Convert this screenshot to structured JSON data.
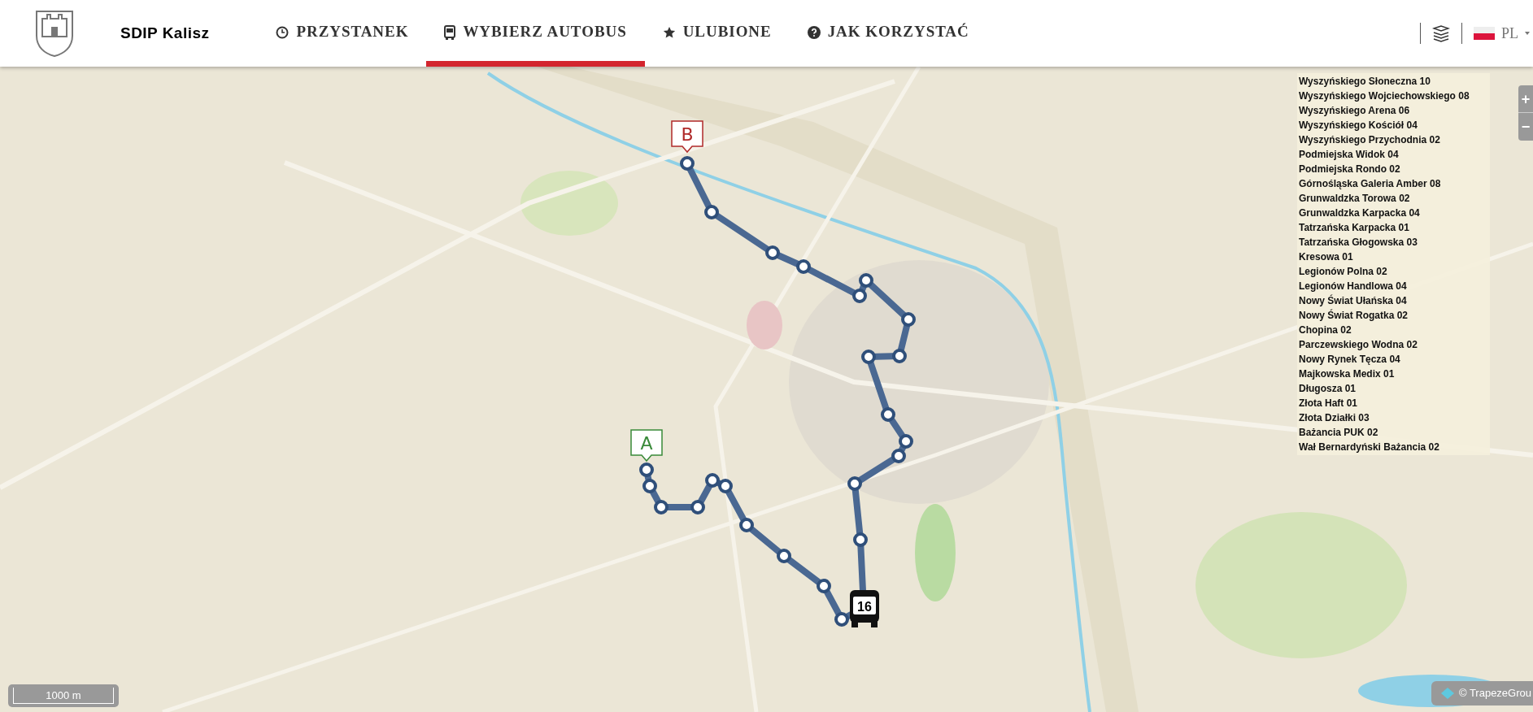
{
  "header": {
    "title": "SDIP Kalisz",
    "nav": [
      {
        "label": "PRZYSTANEK",
        "selected": false
      },
      {
        "label": "WYBIERZ AUTOBUS",
        "selected": true
      },
      {
        "label": "ULUBIONE",
        "selected": false
      },
      {
        "label": "JAK KORZYSTAĆ",
        "selected": false
      }
    ],
    "language": "PL"
  },
  "map": {
    "kind": "picture",
    "markers": [
      {
        "label": "A"
      },
      {
        "label": "B"
      }
    ],
    "bus": {
      "line": "16"
    },
    "zoom_buttons": [
      "+",
      "−"
    ],
    "scale": "1000 m",
    "attribution": "© TrapezeGrou"
  },
  "stops": [
    "Wyszyńskiego Słoneczna 10",
    "Wyszyńskiego Wojciechowskiego 08",
    "Wyszyńskiego Arena 06",
    "Wyszyńskiego Kościół 04",
    "Wyszyńskiego Przychodnia 02",
    "Podmiejska Widok 04",
    "Podmiejska Rondo 02",
    "Górnośląska Galeria Amber 08",
    "Grunwaldzka Torowa 02",
    "Grunwaldzka Karpacka 04",
    "Tatrzańska Karpacka 01",
    "Tatrzańska Głogowska 03",
    "Kresowa 01",
    "Legionów Polna 02",
    "Legionów Handlowa 04",
    "Nowy Świat Ułańska 04",
    "Nowy Świat Rogatka 02",
    "Chopina 02",
    "Parczewskiego Wodna 02",
    "Nowy Rynek Tęcza 04",
    "Majkowska Medix 01",
    "Długosza 01",
    "Złota Haft 01",
    "Złota Działki 03",
    "Bażancia PUK 02",
    "Wał Bernardyński Bażancia 02"
  ]
}
